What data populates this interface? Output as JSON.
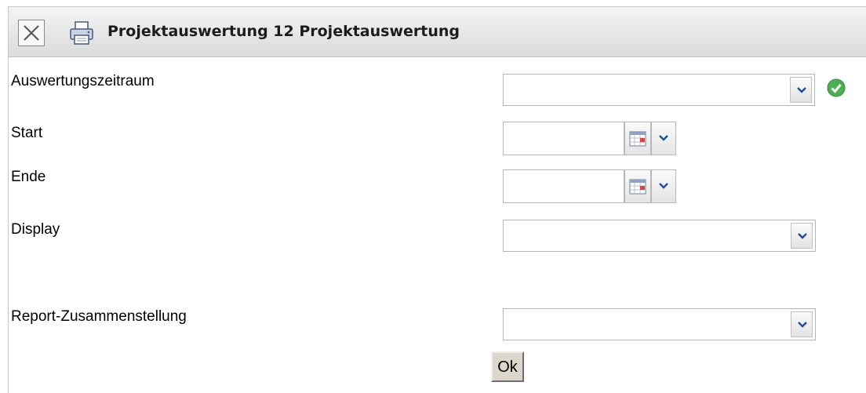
{
  "header": {
    "title": "Projektauswertung 12 Projektauswertung",
    "close_icon": "close-icon",
    "print_icon": "printer-icon"
  },
  "form": {
    "auswertungszeitraum": {
      "label": "Auswertungszeitraum",
      "value": "",
      "status_icon": "check-circle-icon",
      "status_color": "#4caf50"
    },
    "start": {
      "label": "Start",
      "value": ""
    },
    "ende": {
      "label": "Ende",
      "value": ""
    },
    "display": {
      "label": "Display",
      "value": ""
    },
    "report": {
      "label": "Report-Zusammenstellung",
      "value": ""
    },
    "ok_label": "Ok"
  }
}
